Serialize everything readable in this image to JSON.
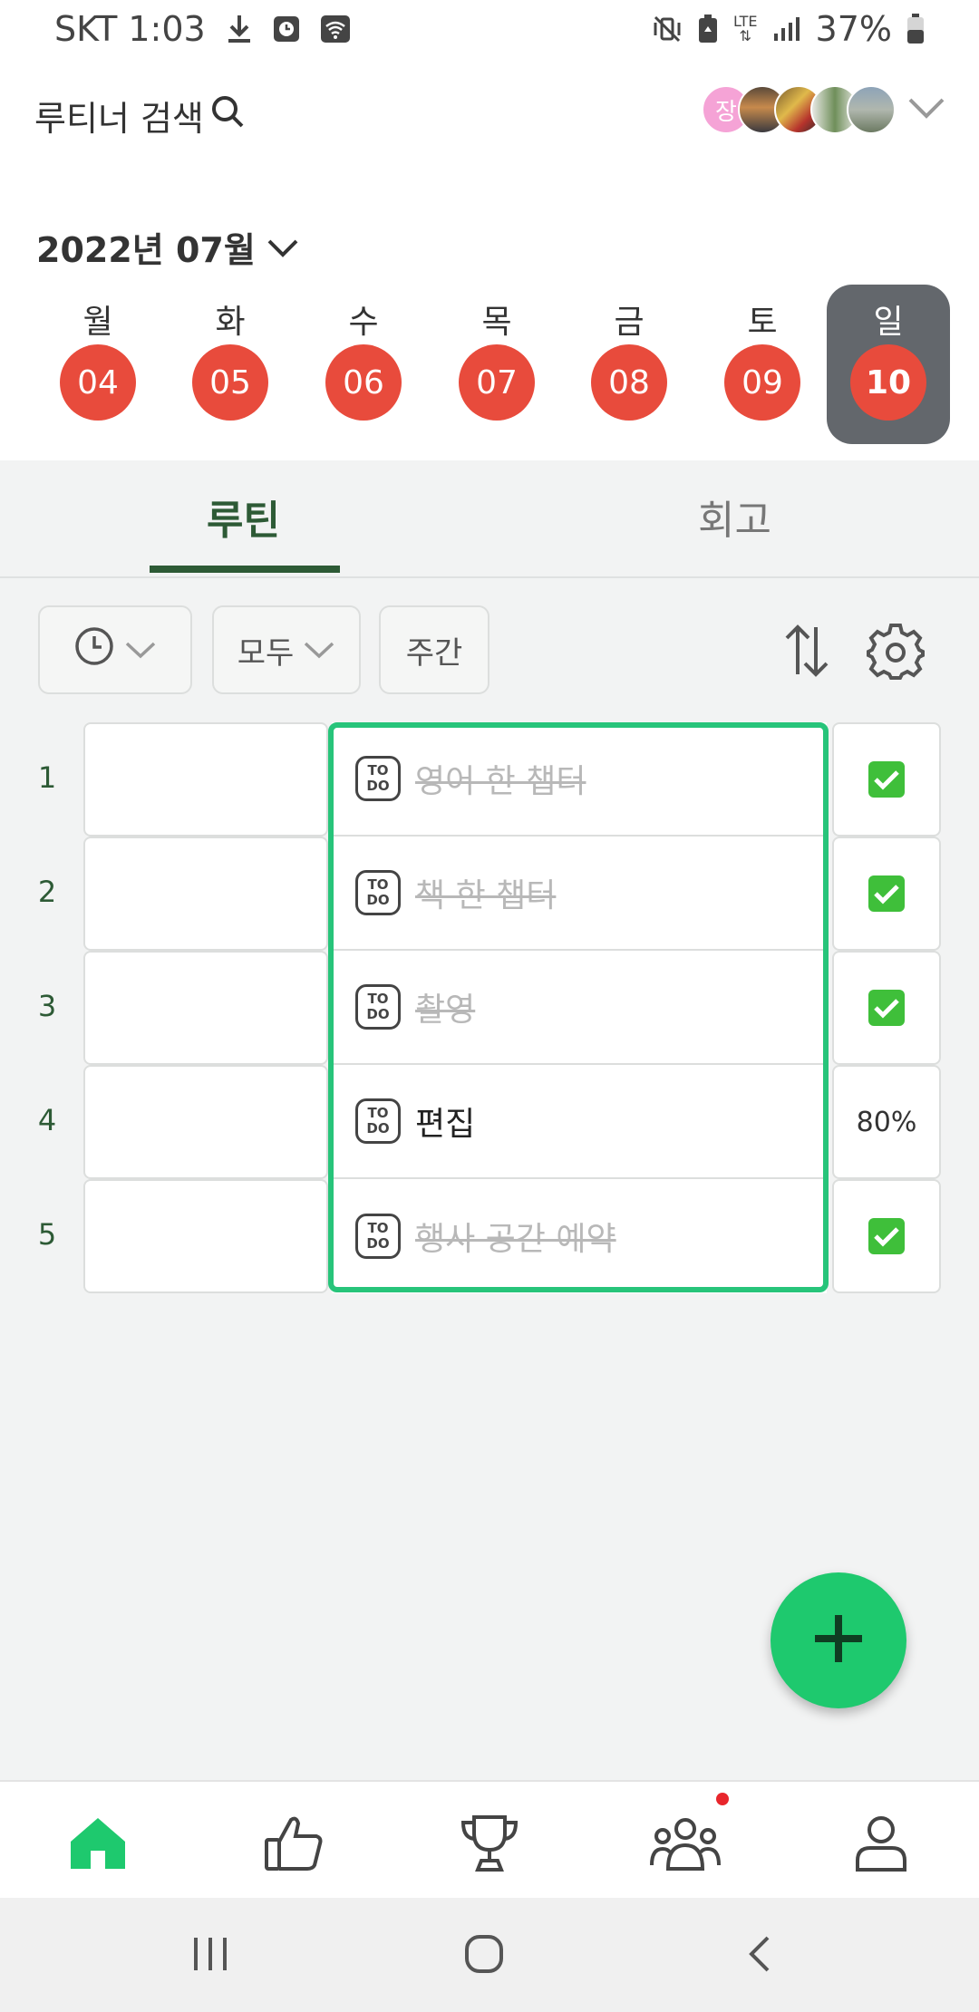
{
  "status_bar": {
    "carrier_time": "SKT 1:03",
    "network": "LTE",
    "battery": "37%"
  },
  "header": {
    "search_label": "루티너 검색",
    "avatar_initial": "장"
  },
  "calendar": {
    "month_label": "2022년 07월",
    "days": [
      {
        "weekday": "월",
        "date": "04"
      },
      {
        "weekday": "화",
        "date": "05"
      },
      {
        "weekday": "수",
        "date": "06"
      },
      {
        "weekday": "목",
        "date": "07"
      },
      {
        "weekday": "금",
        "date": "08"
      },
      {
        "weekday": "토",
        "date": "09"
      },
      {
        "weekday": "일",
        "date": "10"
      }
    ],
    "selected_date": "10"
  },
  "tabs": {
    "routine": "루틴",
    "review": "회고"
  },
  "filters": {
    "all_label": "모두",
    "weekly_label": "주간"
  },
  "routines": [
    {
      "num": "1",
      "title": "영어 한 챕터",
      "status": "done"
    },
    {
      "num": "2",
      "title": "책 한 챕터",
      "status": "done"
    },
    {
      "num": "3",
      "title": "촬영",
      "status": "done"
    },
    {
      "num": "4",
      "title": "편집",
      "status": "80%"
    },
    {
      "num": "5",
      "title": "행사 공간 예약",
      "status": "done"
    }
  ],
  "todo_badge": {
    "top": "TO",
    "bottom": "DO"
  },
  "colors": {
    "accent_green": "#1ec96e",
    "frame_green": "#27c47a",
    "date_red": "#e84b3c",
    "tab_dark_green": "#2d5a35"
  }
}
